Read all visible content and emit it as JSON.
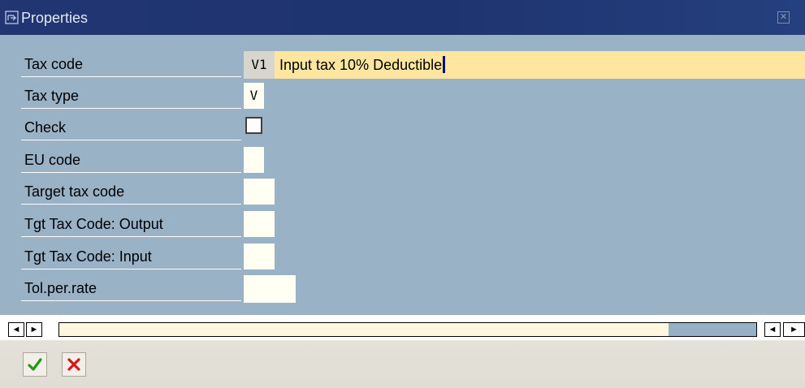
{
  "window": {
    "title": "Properties",
    "title_icon": "properties-icon",
    "close_icon": "close-icon"
  },
  "form": {
    "fields": [
      {
        "label": "Tax code",
        "value": "V1",
        "description": "Input tax 10% Deductible"
      },
      {
        "label": "Tax type",
        "value": "V"
      },
      {
        "label": "Check",
        "checked": false
      },
      {
        "label": "EU code",
        "value": ""
      },
      {
        "label": "Target tax code",
        "value": ""
      },
      {
        "label": "Tgt Tax Code: Output",
        "value": ""
      },
      {
        "label": "Tgt Tax Code: Input",
        "value": ""
      },
      {
        "label": "Tol.per.rate",
        "value": ""
      }
    ]
  },
  "scrollbar": {
    "left_arrow": "◄",
    "right_arrow": "►",
    "icons": [
      "scroll-left-icon",
      "scroll-right-icon"
    ]
  },
  "toolbar": {
    "buttons": [
      {
        "name": "confirm",
        "icon": "checkmark-icon",
        "color": "#1e9a14"
      },
      {
        "name": "cancel",
        "icon": "cancel-x-icon",
        "color": "#d6141c"
      }
    ]
  },
  "colors": {
    "titlebar": "#203571",
    "content_bg": "#9ab2c5",
    "description_bg": "#ffe6a0",
    "field_bg": "#fffff4"
  }
}
